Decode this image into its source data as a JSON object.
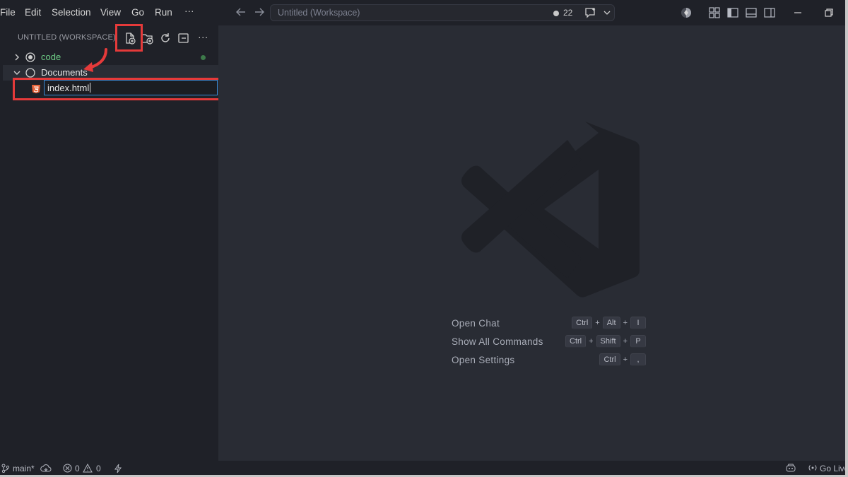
{
  "menu": [
    "File",
    "Edit",
    "Selection",
    "View",
    "Go",
    "Run",
    "···"
  ],
  "command_center": {
    "placeholder": "Untitled (Workspace)",
    "badge_count": "22"
  },
  "explorer": {
    "title": "UNTITLED (WORKSPACE)",
    "actions": [
      "new-file",
      "new-folder",
      "refresh",
      "collapse-all",
      "more"
    ],
    "more_label": "···",
    "tree": [
      {
        "label": "code",
        "expanded": false,
        "color": "#6fcf87",
        "modified": true
      },
      {
        "label": "Documents",
        "expanded": true,
        "color": "#e6e6e6"
      }
    ],
    "rename_input_value": "index.html"
  },
  "shortcuts": [
    {
      "label": "Open Chat",
      "keys": [
        "Ctrl",
        "Alt",
        "I"
      ]
    },
    {
      "label": "Show All Commands",
      "keys": [
        "Ctrl",
        "Shift",
        "P"
      ]
    },
    {
      "label": "Open Settings",
      "keys": [
        "Ctrl",
        ","
      ]
    }
  ],
  "statusbar": {
    "branch": "main*",
    "errors": "0",
    "warnings": "0",
    "go_live": "Go Live"
  },
  "colors": {
    "accent_annotation": "#e53a3a",
    "focus_border": "#3b8bd6",
    "html_icon": "#e8643a"
  }
}
